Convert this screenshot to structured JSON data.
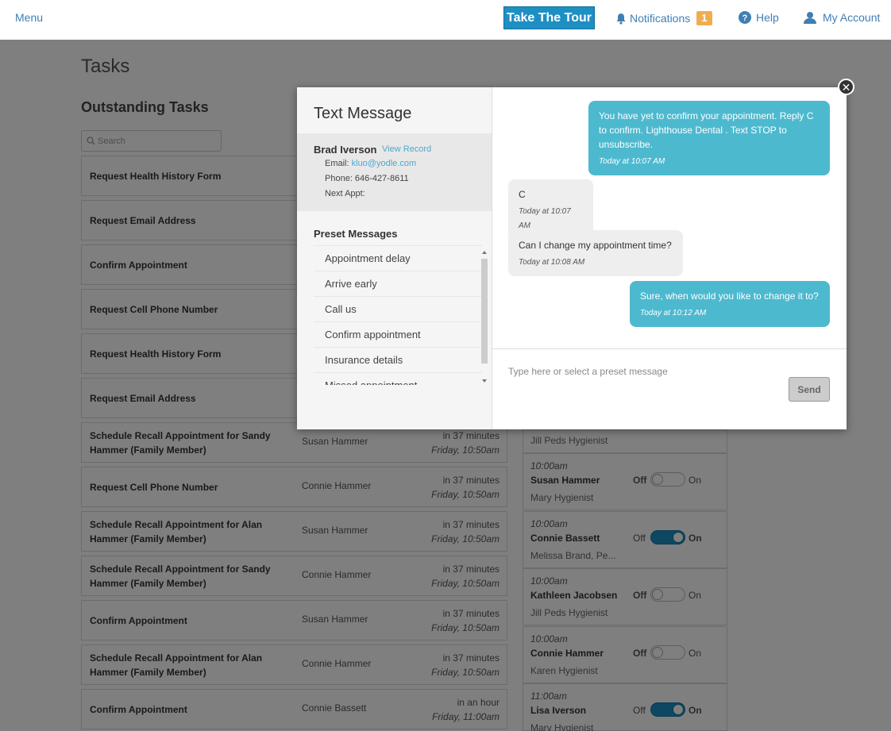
{
  "topbar": {
    "menu": "Menu",
    "tour": "Take The Tour",
    "notifications": "Notifications",
    "notification_count": "1",
    "help": "Help",
    "account": "My Account"
  },
  "page": {
    "title": "Tasks",
    "section": "Outstanding Tasks",
    "search_placeholder": "Search"
  },
  "tasks": [
    {
      "title": "Request Health History Form"
    },
    {
      "title": "Request Email Address"
    },
    {
      "title": "Confirm Appointment"
    },
    {
      "title": "Request Cell Phone Number"
    },
    {
      "title": "Request Health History Form"
    },
    {
      "title": "Request Email Address"
    },
    {
      "title": "Schedule Recall Appointment for Sandy Hammer (Family Member)",
      "who": "Susan Hammer",
      "rel": "in 37 minutes",
      "when": "Friday, 10:50am"
    },
    {
      "title": "Request Cell Phone Number",
      "who": "Connie Hammer",
      "rel": "in 37 minutes",
      "when": "Friday, 10:50am"
    },
    {
      "title": "Schedule Recall Appointment for Alan Hammer (Family Member)",
      "who": "Susan Hammer",
      "rel": "in 37 minutes",
      "when": "Friday, 10:50am"
    },
    {
      "title": "Schedule Recall Appointment for Sandy Hammer (Family Member)",
      "who": "Connie Hammer",
      "rel": "in 37 minutes",
      "when": "Friday, 10:50am"
    },
    {
      "title": "Confirm Appointment",
      "who": "Susan Hammer",
      "rel": "in 37 minutes",
      "when": "Friday, 10:50am"
    },
    {
      "title": "Schedule Recall Appointment for Alan Hammer (Family Member)",
      "who": "Connie Hammer",
      "rel": "in 37 minutes",
      "when": "Friday, 10:50am"
    },
    {
      "title": "Confirm Appointment",
      "who": "Connie Bassett",
      "rel": "in an hour",
      "when": "Friday, 11:00am"
    }
  ],
  "appointments": [
    {
      "sub": "Jill Peds Hygienist"
    },
    {
      "time": "10:00am",
      "name": "Susan Hammer",
      "off": "Off",
      "on": "On",
      "sub": "Mary Hygienist",
      "enabled": false
    },
    {
      "time": "10:00am",
      "name": "Connie Bassett",
      "off": "Off",
      "on": "On",
      "sub": "Melissa Brand, Pe...",
      "enabled": true
    },
    {
      "time": "10:00am",
      "name": "Kathleen Jacobsen",
      "off": "Off",
      "on": "On",
      "sub": "Jill Peds Hygienist",
      "enabled": false
    },
    {
      "time": "10:00am",
      "name": "Connie Hammer",
      "off": "Off",
      "on": "On",
      "sub": "Karen Hygienist",
      "enabled": false
    },
    {
      "time": "11:00am",
      "name": "Lisa Iverson",
      "off": "Off",
      "on": "On",
      "sub": "Mary Hygienist",
      "enabled": true
    }
  ],
  "modal": {
    "title": "Text Message",
    "contact": {
      "name": "Brad Iverson",
      "view_record": "View Record",
      "email_label": "Email:",
      "email": "kluo@yodle.com",
      "phone": "Phone: 646-427-8611",
      "next_appt": "Next Appt:"
    },
    "preset_title": "Preset Messages",
    "presets": [
      "Appointment delay",
      "Arrive early",
      "Call us",
      "Confirm appointment",
      "Insurance details",
      "Missed appointment"
    ],
    "messages": [
      {
        "dir": "out",
        "text": "You have yet to confirm your appointment. Reply C to confirm. Lighthouse Dental . Text STOP to unsubscribe.",
        "ts": "Today at 10:07 AM"
      },
      {
        "dir": "in",
        "text": "C",
        "ts": "Today at 10:07 AM"
      },
      {
        "dir": "in",
        "text": "Can I change my appointment time?",
        "ts": "Today at 10:08 AM"
      },
      {
        "dir": "out",
        "text": "Sure, when would you like to change it to?",
        "ts": "Today at 10:12 AM"
      }
    ],
    "compose_placeholder": "Type here or select a preset message",
    "send": "Send"
  },
  "colors": {
    "accent": "#1d8fc3",
    "bubble_out": "#4db9cf",
    "badge": "#f0ad4e"
  }
}
